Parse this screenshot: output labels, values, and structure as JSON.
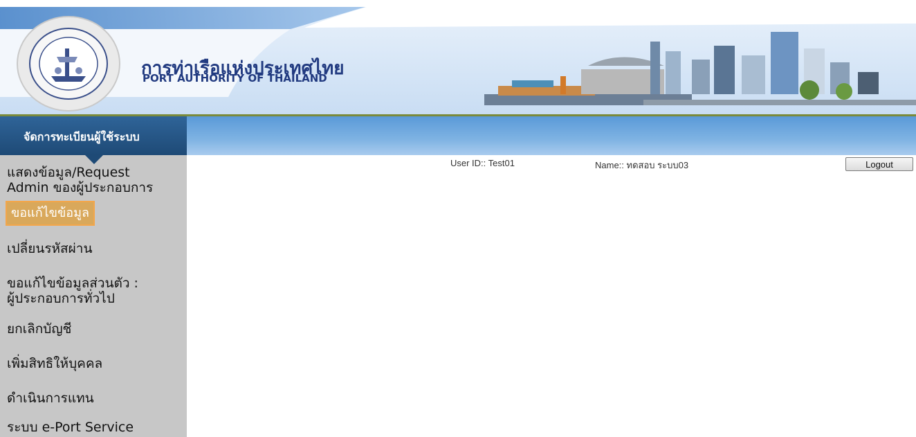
{
  "header": {
    "org_name_thai": "การท่าเรือแห่งประเทศไทย",
    "org_name_en": "PORT AUTHORITY OF THAILAND"
  },
  "sidebar": {
    "title": "จัดการทะเบียนผู้ใช้ระบบ",
    "items": [
      {
        "label_line1": "แสดงข้อมูล/Request",
        "label_line2": "Admin ของผู้ประกอบการ"
      },
      {
        "label_line1": "ขอแก้ไขข้อมูล",
        "label_line2": ""
      },
      {
        "label_line1": "เปลี่ยนรหัสผ่าน",
        "label_line2": ""
      },
      {
        "label_line1": "ขอแก้ไขข้อมูลส่วนตัว :",
        "label_line2": "ผู้ประกอบการทั่วไป"
      },
      {
        "label_line1": "ยกเลิกบัญชี",
        "label_line2": ""
      },
      {
        "label_line1": "เพิ่มสิทธิให้บุคคล",
        "label_line2": ""
      },
      {
        "label_line1": "ดำเนินการแทน",
        "label_line2": ""
      },
      {
        "label_line1": "ระบบ e-Port Service",
        "label_line2": ""
      }
    ],
    "active_index": 1
  },
  "user_bar": {
    "user_id_text": "User ID:: Test01",
    "name_text": "Name:: ทดสอบ ระบบ03",
    "logout_label": "Logout"
  },
  "colors": {
    "brand_blue": "#213a80",
    "nav_blue": "#5a9ad8",
    "sidebar_bg": "#c7c7c7",
    "active_item": "#d9a85b"
  }
}
